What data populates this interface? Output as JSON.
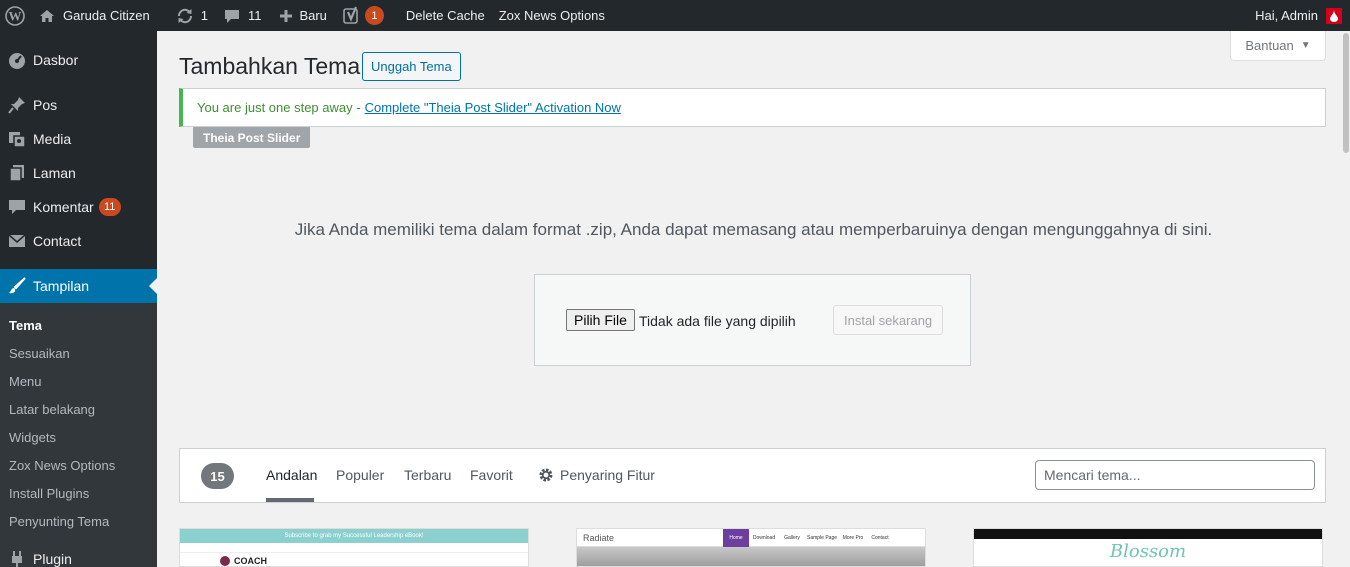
{
  "adminbar": {
    "site_name": "Garuda Citizen",
    "updates_count": "1",
    "comments_count": "11",
    "new_label": "Baru",
    "yoast_count": "1",
    "delete_cache": "Delete Cache",
    "zox_options": "Zox News Options",
    "greeting": "Hai, Admin"
  },
  "sidebar": {
    "items": [
      {
        "label": "Dasbor",
        "icon": "dashboard-icon"
      },
      {
        "label": "Pos",
        "icon": "pin-icon"
      },
      {
        "label": "Media",
        "icon": "media-icon"
      },
      {
        "label": "Laman",
        "icon": "pages-icon"
      },
      {
        "label": "Komentar",
        "icon": "comments-icon",
        "badge": "11"
      },
      {
        "label": "Contact",
        "icon": "mail-icon"
      },
      {
        "label": "Tampilan",
        "icon": "brush-icon"
      },
      {
        "label": "Plugin",
        "icon": "plugin-icon"
      }
    ],
    "submenu": [
      "Tema",
      "Sesuaikan",
      "Menu",
      "Latar belakang",
      "Widgets",
      "Zox News Options",
      "Install Plugins",
      "Penyunting Tema"
    ]
  },
  "main": {
    "help_label": "Bantuan",
    "title": "Tambahkan Tema",
    "upload_button": "Unggah Tema",
    "notice_text": "You are just one step away -",
    "notice_link": "Complete \"Theia Post Slider\" Activation Now",
    "notice_tag": "Theia Post Slider",
    "upload_desc": "Jika Anda memiliki tema dalam format .zip, Anda dapat memasang atau memperbaruinya dengan mengunggahnya di sini.",
    "choose_file": "Pilih File",
    "no_file": "Tidak ada file yang dipilih",
    "install_now": "Instal sekarang",
    "theme_count": "15",
    "tabs": [
      "Andalan",
      "Populer",
      "Terbaru",
      "Favorit"
    ],
    "feature_filter": "Penyaring Fitur",
    "search_placeholder": "Mencari tema..."
  },
  "themes": [
    {
      "banner": "Subscribe to grab my Successful Leadership eBook!",
      "title": "COACH"
    },
    {
      "title": "Radiate",
      "nav": [
        "Home",
        "Download",
        "Gallery",
        "Sample Page",
        "More Pro",
        "Contact"
      ]
    },
    {
      "title": "Blossom"
    }
  ],
  "colors": {
    "adminbar_bg": "#23282d",
    "sidebar_bg": "#23282d",
    "active_menu": "#0073aa",
    "badge": "#ca4a1f",
    "notice_green": "#46b450"
  }
}
